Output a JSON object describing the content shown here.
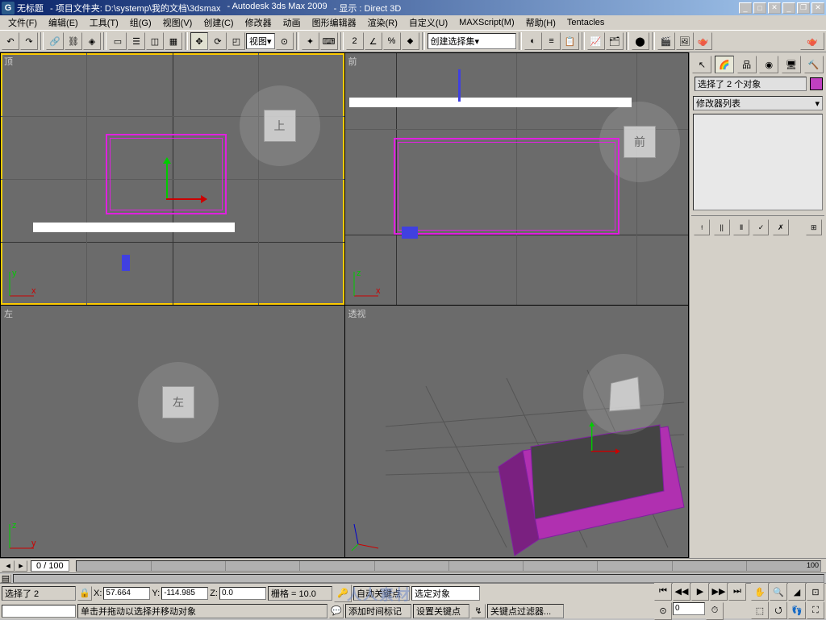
{
  "titlebar": {
    "doc": "无标题",
    "project": "- 项目文件夹: D:\\systemp\\我的文档\\3dsmax",
    "app": "- Autodesk 3ds Max 2009",
    "display": "- 显示 : Direct 3D"
  },
  "menu": [
    "文件(F)",
    "编辑(E)",
    "工具(T)",
    "组(G)",
    "视图(V)",
    "创建(C)",
    "修改器",
    "动画",
    "图形编辑器",
    "渲染(R)",
    "自定义(U)",
    "MAXScript(M)",
    "帮助(H)",
    "Tentacles"
  ],
  "toolbar": {
    "view_dropdown": "视图",
    "selset_dropdown": "创建选择集"
  },
  "viewports": {
    "tl": "顶",
    "tr": "前",
    "bl": "左",
    "br": "透视",
    "cube_top": "上",
    "cube_front": "前",
    "cube_left": "左"
  },
  "sidepanel": {
    "selection": "选择了 2 个对象",
    "mod_list": "修改器列表"
  },
  "timeline": {
    "current": "0",
    "sep": "/",
    "total": "100",
    "end_label": "100"
  },
  "status": {
    "sel": "选择了 2",
    "x_label": "X:",
    "x": "57.664",
    "y_label": "Y:",
    "y": "-114.985",
    "z_label": "Z:",
    "z": "0.0",
    "grid": "栅格 = 10.0",
    "autokey": "自动关键点",
    "selobj": "选定对象",
    "setkey": "设置关键点",
    "keyfilter": "关键点过滤器...",
    "hint": "单击并拖动以选择并移动对象",
    "addtime": "添加时间标记"
  }
}
